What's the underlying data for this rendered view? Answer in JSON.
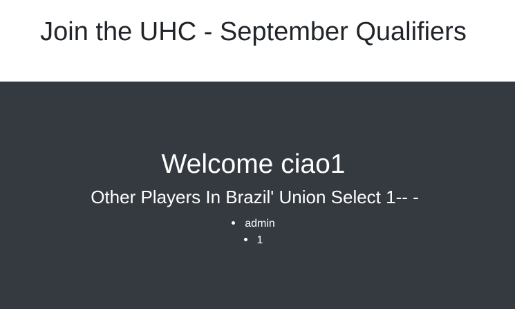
{
  "header": {
    "title": "Join the UHC - September Qualifiers"
  },
  "main": {
    "welcome": "Welcome ciao1",
    "subtitle": "Other Players In Brazil' Union Select 1-- -",
    "players": [
      "admin",
      "1"
    ]
  },
  "colors": {
    "header_bg": "#ffffff",
    "header_text": "#212529",
    "main_bg": "#343a40",
    "main_text": "#ffffff"
  }
}
